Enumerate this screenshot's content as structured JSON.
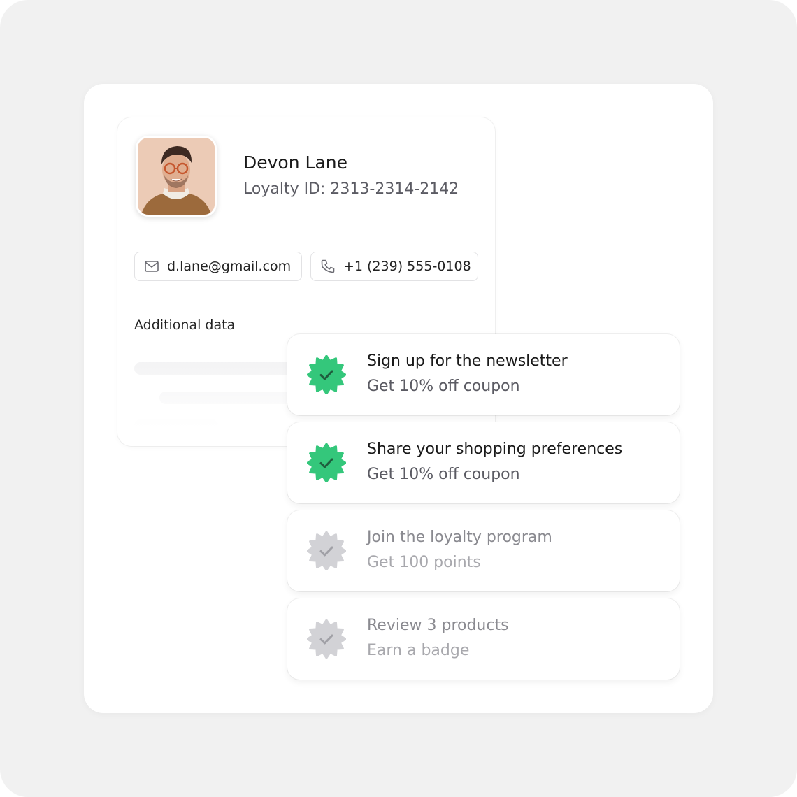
{
  "profile": {
    "name": "Devon Lane",
    "loyalty_id": "Loyalty ID: 2313-2314-2142",
    "avatar_alt": "profile photo",
    "email": "d.lane@gmail.com",
    "phone": "+1 (239) 555-0108",
    "section_title": "Additional data"
  },
  "tasks": [
    {
      "title": "Sign up for the newsletter",
      "reward": "Get 10% off coupon",
      "completed": true
    },
    {
      "title": "Share your shopping preferences",
      "reward": "Get 10% off coupon",
      "completed": true
    },
    {
      "title": "Join the loyalty program",
      "reward": "Get 100 points",
      "completed": false
    },
    {
      "title": "Review 3 products",
      "reward": "Earn a badge",
      "completed": false
    }
  ],
  "colors": {
    "background": "#f1f1f1",
    "badge_active": "#34c77b",
    "badge_inactive": "#d2d2d6",
    "check_active": "#1f5d3d",
    "check_inactive": "#a0a0a6"
  },
  "icons": {
    "email": "mail-icon",
    "phone": "phone-icon",
    "badge": "verified-badge-icon"
  }
}
